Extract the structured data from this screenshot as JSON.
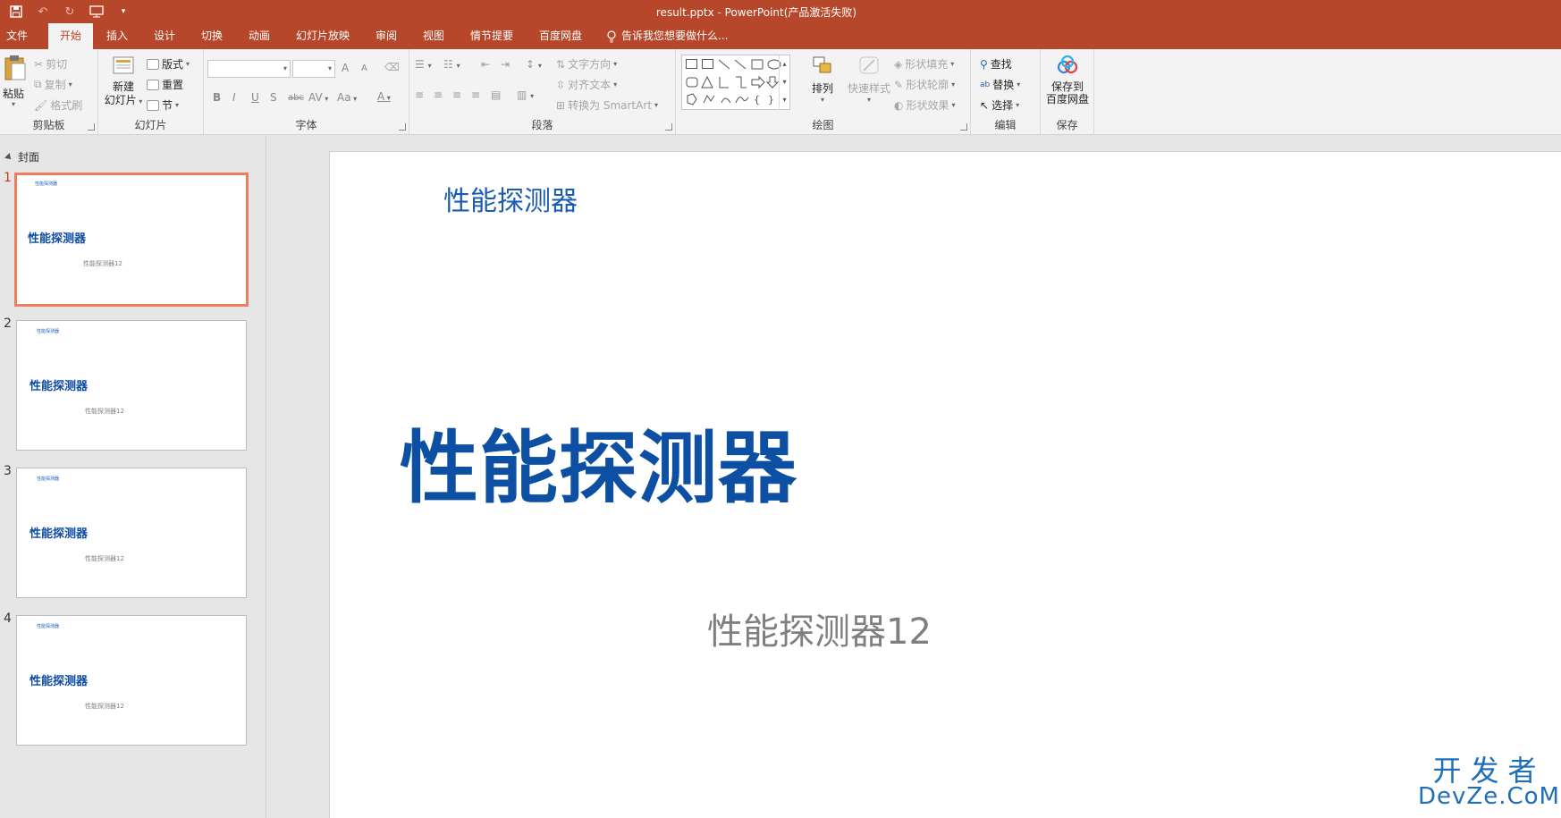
{
  "window": {
    "title": "result.pptx - PowerPoint(产品激活失败)"
  },
  "qat": {
    "save_icon": "save-icon",
    "undo_icon": "undo-icon",
    "redo_icon": "redo-icon",
    "present_icon": "start-from-beginning-icon",
    "customize_icon": "customize-qat-icon"
  },
  "tabs": [
    "文件",
    "开始",
    "插入",
    "设计",
    "切换",
    "动画",
    "幻灯片放映",
    "审阅",
    "视图",
    "情节提要",
    "百度网盘"
  ],
  "active_tab": "开始",
  "tell_me": "告诉我您想要做什么...",
  "ribbon": {
    "clipboard": {
      "label": "剪贴板",
      "paste": "粘贴",
      "cut": "剪切",
      "copy": "复制",
      "format_painter": "格式刷"
    },
    "slides": {
      "label": "幻灯片",
      "new_slide_1": "新建",
      "new_slide_2": "幻灯片",
      "layout": "版式",
      "reset": "重置",
      "section": "节"
    },
    "font": {
      "label": "字体",
      "font_name": "",
      "font_size": "",
      "grow": "A",
      "shrink": "A",
      "bold": "B",
      "italic": "I",
      "underline": "U",
      "shadow": "S",
      "strike": "abc",
      "spacing": "AV",
      "case": "Aa",
      "color": "A"
    },
    "paragraph": {
      "label": "段落",
      "text_direction": "文字方向",
      "align_text": "对齐文本",
      "smartart": "转换为 SmartArt"
    },
    "drawing": {
      "label": "绘图",
      "arrange": "排列",
      "quick_styles": "快速样式",
      "shape_fill": "形状填充",
      "shape_outline": "形状轮廓",
      "shape_effects": "形状效果"
    },
    "editing": {
      "label": "编辑",
      "find": "查找",
      "replace": "替换",
      "select": "选择"
    },
    "save": {
      "label": "保存",
      "save_baidu_1": "保存到",
      "save_baidu_2": "百度网盘"
    }
  },
  "pane": {
    "section_name": "封面",
    "slides": [
      {
        "num": "1",
        "small": "性能探测器",
        "title": "性能探测器",
        "sub": "性能探测器12"
      },
      {
        "num": "2",
        "small": "性能探测器",
        "title": "性能探测器",
        "sub": "性能探测器12"
      },
      {
        "num": "3",
        "small": "性能探测器",
        "title": "性能探测器",
        "sub": "性能探测器12"
      },
      {
        "num": "4",
        "small": "性能探测器",
        "title": "性能探测器",
        "sub": "性能探测器12"
      }
    ]
  },
  "slide": {
    "small_title": "性能探测器",
    "title": "性能探测器",
    "subtitle": "性能探测器12"
  },
  "watermark": {
    "line1": "开发者",
    "line2": "DevZe.CoM"
  },
  "colors": {
    "accent": "#b7472a",
    "title_blue": "#0c4fa3",
    "selection": "#ee7c5d"
  }
}
